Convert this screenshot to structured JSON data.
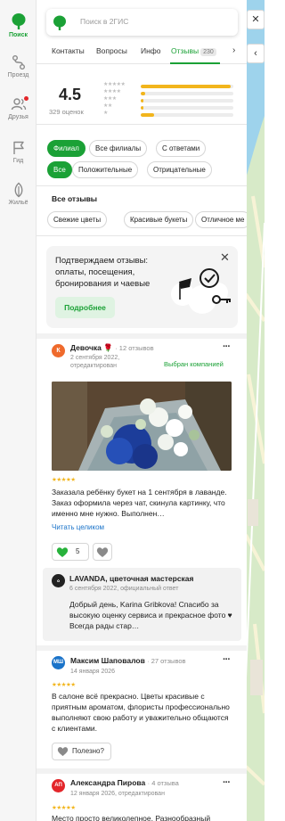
{
  "colors": {
    "accent": "#1ba136",
    "star": "#f2b51c",
    "link": "#1a73c9",
    "notify": "#e3262a"
  },
  "rail": {
    "items": [
      {
        "label": "Поиск",
        "icon": "search-tree-icon",
        "active": true
      },
      {
        "label": "Проезд",
        "icon": "route-icon"
      },
      {
        "label": "Друзья",
        "icon": "friends-icon"
      },
      {
        "label": "Гид",
        "icon": "flag-icon"
      },
      {
        "label": "Жильё",
        "icon": "housing-icon"
      }
    ]
  },
  "search": {
    "placeholder": "Поиск в 2ГИС"
  },
  "tabs": {
    "items": [
      {
        "label": "Контакты"
      },
      {
        "label": "Вопросы"
      },
      {
        "label": "Инфо"
      },
      {
        "label": "Отзывы",
        "badge": "230"
      }
    ],
    "active": "Отзывы"
  },
  "rating": {
    "value": "4.5",
    "count_label": "329 оценок",
    "distribution": [
      {
        "stars": 5,
        "share": 0.97
      },
      {
        "stars": 4,
        "share": 0.05
      },
      {
        "stars": 3,
        "share": 0.03
      },
      {
        "stars": 2,
        "share": 0.03
      },
      {
        "stars": 1,
        "share": 0.14
      }
    ]
  },
  "filters": {
    "scope": [
      {
        "label": "Филиал",
        "active": true
      },
      {
        "label": "Все филиалы"
      },
      {
        "label": "С ответами"
      }
    ],
    "sentiment": [
      {
        "label": "Все",
        "active": true
      },
      {
        "label": "Положительные"
      },
      {
        "label": "Отрицательные"
      }
    ]
  },
  "all_reviews": {
    "heading": "Все отзывы",
    "tags": [
      "Свежие цветы",
      "Красивые букеты",
      "Отличное ме"
    ]
  },
  "promo": {
    "text": "Подтверждаем отзывы: оплаты, посещения, бронирования и чаевые",
    "button": "Подробнее"
  },
  "reviews": [
    {
      "initial": "К",
      "avatar_color": "#ef6a2c",
      "author": "Девочка 🌹",
      "reviews_count": "· 12 отзывов",
      "date": "2 сентября 2022,",
      "date2": "отредактирован",
      "badge": "Выбран компанией",
      "rating": 5,
      "text": "Заказала ребёнку букет на 1 сентября в лаванде. Заказ оформила через чат, скинула картинку, что именно мне нужно. Выполнен…",
      "read_more": "Читать целиком",
      "likes": "5",
      "reply": {
        "author": "LAVANDA, цветочная мастерская",
        "date": "6 сентября 2022, официальный ответ",
        "text": "Добрый день, Karina Gribkova! Спасибо за высокую оценку сервиса и прекрасное фото ♥ Всегда рады стар…"
      }
    },
    {
      "initial": "МШ",
      "avatar_color": "#1a73c9",
      "author": "Максим Шаповалов",
      "reviews_count": "· 27 отзывов",
      "date": "14 января 2026",
      "rating": 5,
      "text": "В салоне всё прекрасно. Цветы красивые с приятным ароматом, флористы профессионально выполняют свою работу и уважительно общаются с клиентами.",
      "useful_label": "Полезно?"
    },
    {
      "initial": "АП",
      "avatar_color": "#e3262a",
      "author": "Александра Пирова",
      "reviews_count": "· 4 отзыва",
      "date": "12 января 2026, отредактирован",
      "rating": 5,
      "text": "Место просто великолепное. Разнообразный"
    }
  ]
}
